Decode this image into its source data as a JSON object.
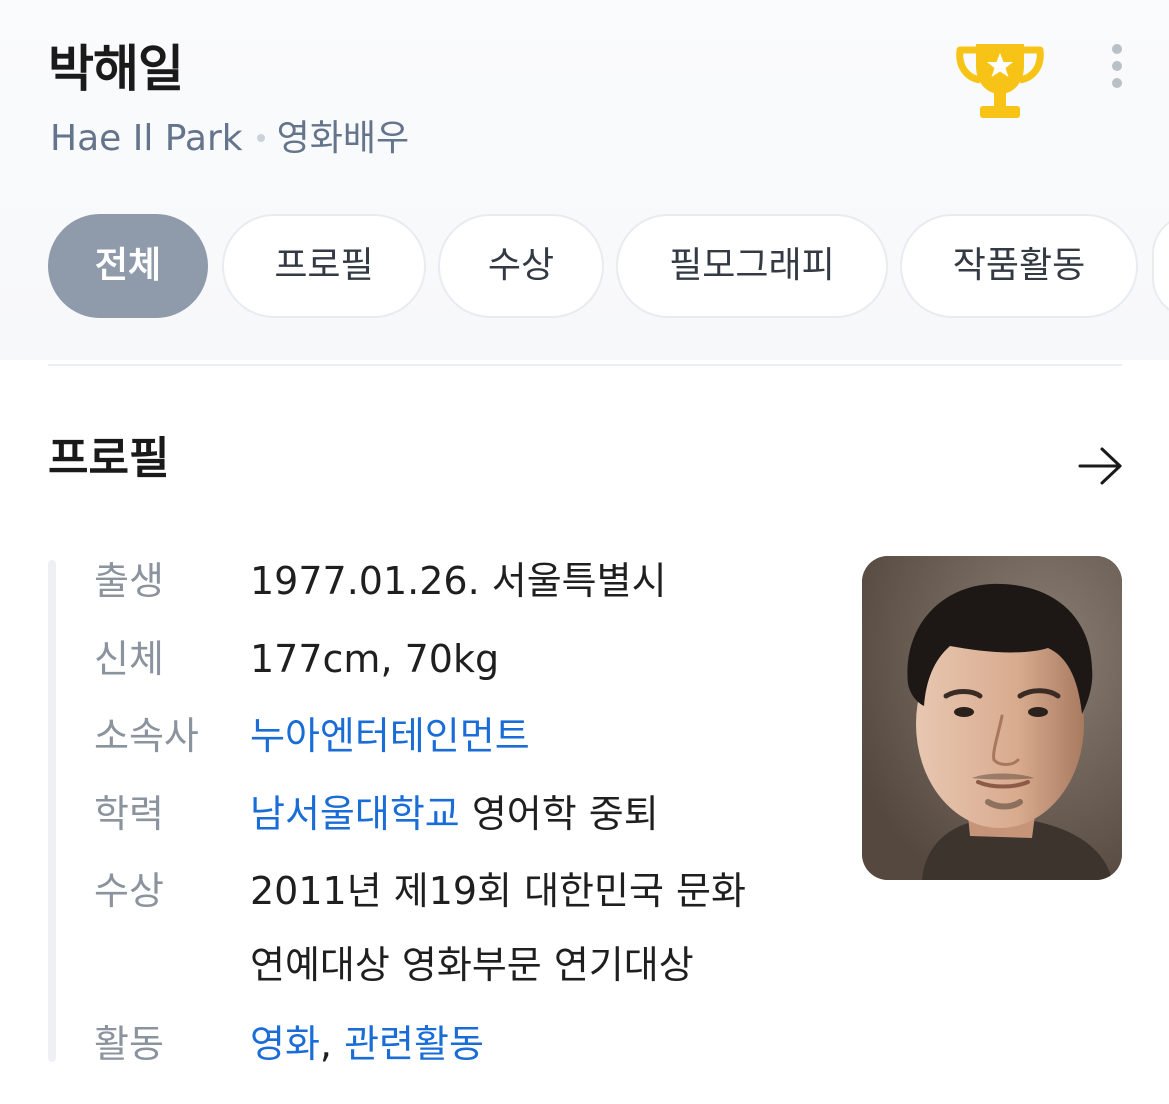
{
  "header": {
    "name": "박해일",
    "name_en": "Hae Il Park",
    "occupation": "영화배우",
    "trophy_icon": "trophy-icon",
    "more_icon": "more-vertical-icon"
  },
  "tabs": [
    {
      "label": "전체",
      "active": true
    },
    {
      "label": "프로필",
      "active": false
    },
    {
      "label": "수상",
      "active": false
    },
    {
      "label": "필모그래피",
      "active": false
    },
    {
      "label": "작품활동",
      "active": false
    }
  ],
  "section": {
    "title": "프로필",
    "arrow_icon": "arrow-right-icon"
  },
  "profile": {
    "birth": {
      "label": "출생",
      "value": "1977.01.26. 서울특별시"
    },
    "body": {
      "label": "신체",
      "value": "177cm, 70kg"
    },
    "agency": {
      "label": "소속사",
      "link": "누아엔터테인먼트"
    },
    "education": {
      "label": "학력",
      "link": "남서울대학교",
      "rest": " 영어학 중퇴"
    },
    "award": {
      "label": "수상",
      "line1": "2011년 제19회 대한민국 문화",
      "line2": "연예대상 영화부문 연기대상"
    },
    "activity": {
      "label": "활동",
      "link1": "영화",
      "separator": ", ",
      "link2": "관련활동"
    }
  },
  "colors": {
    "link": "#1a6dd6",
    "active_tab": "#8f9bab",
    "label": "#8a939e",
    "trophy": "#f7c316"
  }
}
